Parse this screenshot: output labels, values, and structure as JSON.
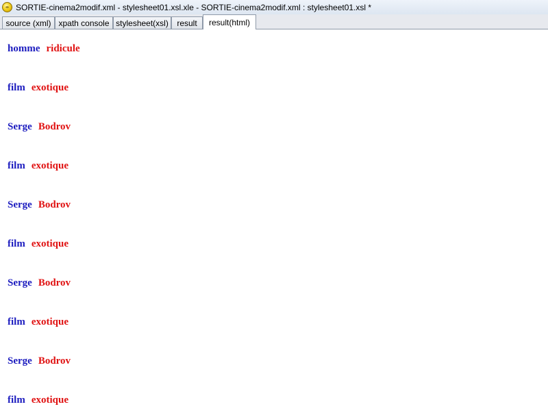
{
  "window": {
    "title": "SORTIE-cinema2modif.xml - stylesheet01.xsl.xle - SORTIE-cinema2modif.xml : stylesheet01.xsl *",
    "icon": "xml-editor-app-icon"
  },
  "tabs": [
    {
      "label": "source (xml)",
      "active": false
    },
    {
      "label": "xpath console",
      "active": false
    },
    {
      "label": "stylesheet(xsl)",
      "active": false
    },
    {
      "label": "result",
      "active": false
    },
    {
      "label": "result(html)",
      "active": true
    }
  ],
  "colors": {
    "label": "#1c1cbf",
    "value": "#e01212"
  },
  "rows": [
    {
      "label": "homme",
      "value": "ridicule"
    },
    {
      "label": "film",
      "value": "exotique"
    },
    {
      "label": "Serge",
      "value": "Bodrov"
    },
    {
      "label": "film",
      "value": "exotique"
    },
    {
      "label": "Serge",
      "value": "Bodrov"
    },
    {
      "label": "film",
      "value": "exotique"
    },
    {
      "label": "Serge",
      "value": "Bodrov"
    },
    {
      "label": "film",
      "value": "exotique"
    },
    {
      "label": "Serge",
      "value": "Bodrov"
    },
    {
      "label": "film",
      "value": "exotique"
    }
  ]
}
